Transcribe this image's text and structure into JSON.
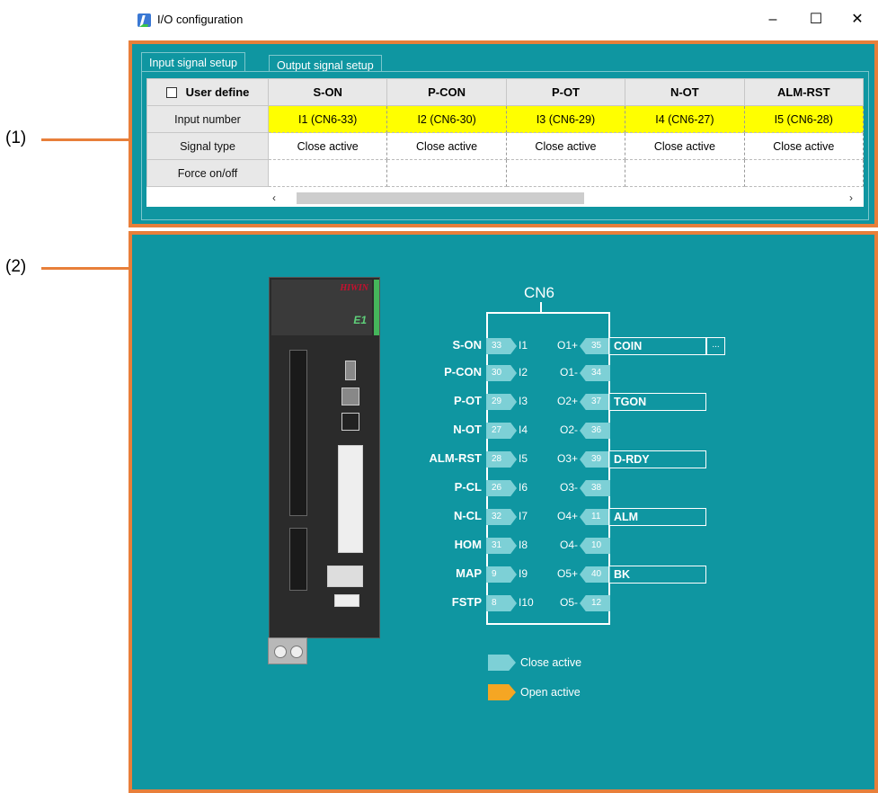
{
  "callouts": {
    "one": "(1)",
    "two": "(2)"
  },
  "window": {
    "title": "I/O configuration",
    "minimize": "–",
    "maximize": "☐",
    "close": "✕"
  },
  "tabs": [
    {
      "label": "Input signal setup",
      "active": true
    },
    {
      "label": "Output signal setup",
      "active": false
    }
  ],
  "grid": {
    "corner_label": "User define",
    "row_headers": [
      "Input number",
      "Signal type",
      "Force on/off"
    ],
    "columns": [
      {
        "header": "S-ON",
        "input_number": "I1 (CN6-33)",
        "signal_type": "Close active",
        "force": ""
      },
      {
        "header": "P-CON",
        "input_number": "I2 (CN6-30)",
        "signal_type": "Close active",
        "force": ""
      },
      {
        "header": "P-OT",
        "input_number": "I3 (CN6-29)",
        "signal_type": "Close active",
        "force": ""
      },
      {
        "header": "N-OT",
        "input_number": "I4 (CN6-27)",
        "signal_type": "Close active",
        "force": ""
      },
      {
        "header": "ALM-RST",
        "input_number": "I5 (CN6-28)",
        "signal_type": "Close active",
        "force": ""
      }
    ]
  },
  "drive": {
    "brand": "HIWIN",
    "model": "E1"
  },
  "cn6": {
    "title": "CN6",
    "inputs": [
      {
        "signal": "S-ON",
        "pin": "33",
        "name": "I1"
      },
      {
        "signal": "P-CON",
        "pin": "30",
        "name": "I2"
      },
      {
        "signal": "P-OT",
        "pin": "29",
        "name": "I3"
      },
      {
        "signal": "N-OT",
        "pin": "27",
        "name": "I4"
      },
      {
        "signal": "ALM-RST",
        "pin": "28",
        "name": "I5"
      },
      {
        "signal": "P-CL",
        "pin": "26",
        "name": "I6"
      },
      {
        "signal": "N-CL",
        "pin": "32",
        "name": "I7"
      },
      {
        "signal": "HOM",
        "pin": "31",
        "name": "I8"
      },
      {
        "signal": "MAP",
        "pin": "9",
        "name": "I9"
      },
      {
        "signal": "FSTP",
        "pin": "8",
        "name": "I10"
      }
    ],
    "outputs": [
      {
        "name": "O1+",
        "pin": "35",
        "signal": "COIN"
      },
      {
        "name": "O1-",
        "pin": "34",
        "signal": null
      },
      {
        "name": "O2+",
        "pin": "37",
        "signal": "TGON"
      },
      {
        "name": "O2-",
        "pin": "36",
        "signal": null
      },
      {
        "name": "O3+",
        "pin": "39",
        "signal": "D-RDY"
      },
      {
        "name": "O3-",
        "pin": "38",
        "signal": null
      },
      {
        "name": "O4+",
        "pin": "11",
        "signal": "ALM"
      },
      {
        "name": "O4-",
        "pin": "10",
        "signal": null
      },
      {
        "name": "O5+",
        "pin": "40",
        "signal": "BK"
      },
      {
        "name": "O5-",
        "pin": "12",
        "signal": null
      }
    ],
    "dots_label": "..."
  },
  "legend": [
    {
      "label": "Close active",
      "color": "#7dd0d6"
    },
    {
      "label": "Open active",
      "color": "#f5a623"
    }
  ],
  "colors": {
    "accent_border": "#e87f3a",
    "panel_bg": "#0f96a1",
    "highlight": "#ffff00"
  }
}
